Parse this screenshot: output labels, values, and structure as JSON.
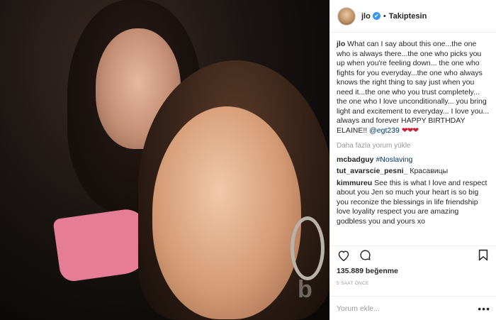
{
  "post": {
    "author": "jlo",
    "follow_status": "Takiptesin",
    "separator": "•",
    "verified_mark": "✔"
  },
  "caption": {
    "user": "jlo",
    "text": "What can I say about this one...the one who is always there...the one who picks you up when you're feeling down... the one who fights for you everyday...the one who always knows the right thing to say just when you need it...the one who you trust completely... the one who I love unconditionally... you bring light and excitement to everyday... I love you... always and forever HAPPY BIRTHDAY ELAINE!!",
    "mention": "@egt239",
    "hearts": "❤❤❤"
  },
  "load_more": "Daha fazla yorum yükle",
  "comments": [
    {
      "user": "mcbadguy",
      "text": "#Noslaving"
    },
    {
      "user": "tut_avarscie_pesni_",
      "text": "Красавицы"
    },
    {
      "user": "kimmureu",
      "text": "See this is what I love and respect about you Jen so much your heart is so big you reconize the blessings in life friendship love loyality respect you are amazing godbless you and yours xo"
    }
  ],
  "likes": "135.889 beğenme",
  "timestamp": "5 SAAT ÖNCE",
  "add_comment": {
    "placeholder": "Yorum ekle..."
  },
  "more_options": "•••",
  "watermark": "b",
  "icons": [
    "heart-icon",
    "comment-icon",
    "bookmark-icon",
    "verified-icon",
    "more-options-icon"
  ]
}
